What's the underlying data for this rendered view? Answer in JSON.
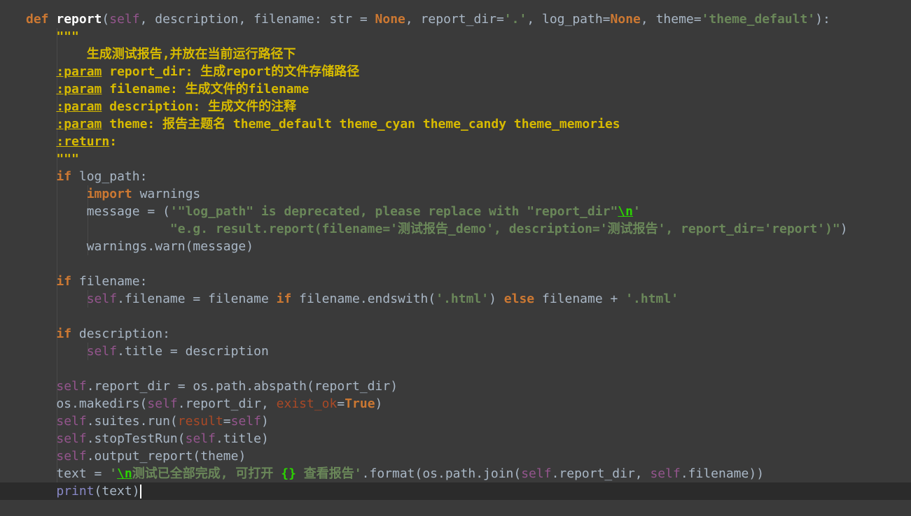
{
  "colors": {
    "background": "#3a3a3a",
    "current_line": "#2b2b2b",
    "default_text": "#a9b7c6",
    "keyword": "#cc7832",
    "function_name": "#ffffff",
    "self": "#94558d",
    "string": "#6a8759",
    "docstring": "#d7ba00",
    "escape": "#2bd400",
    "kwarg": "#aa4926",
    "builtin": "#8888c6"
  },
  "editor": {
    "cursor_line": 27,
    "lines": [
      [
        {
          "t": "def",
          "c": "kw"
        },
        {
          "t": " "
        },
        {
          "t": "report",
          "c": "fn"
        },
        {
          "t": "("
        },
        {
          "t": "self",
          "c": "self"
        },
        {
          "t": ", description, filename: str = "
        },
        {
          "t": "None",
          "c": "kw"
        },
        {
          "t": ", report_dir="
        },
        {
          "t": "'.'",
          "c": "str"
        },
        {
          "t": ", log_path="
        },
        {
          "t": "None",
          "c": "kw"
        },
        {
          "t": ", theme="
        },
        {
          "t": "'theme_default'",
          "c": "str"
        },
        {
          "t": "):"
        }
      ],
      [
        {
          "t": "    \"\"\"",
          "c": "doc"
        }
      ],
      [
        {
          "t": "        生成测试报告,并放在当前运行路径下",
          "c": "doc"
        }
      ],
      [
        {
          "t": "    "
        },
        {
          "t": ":param",
          "c": "doctag"
        },
        {
          "t": " report_dir",
          "c": "doc"
        },
        {
          "t": ": 生成report的文件存储路径",
          "c": "doc"
        }
      ],
      [
        {
          "t": "    "
        },
        {
          "t": ":param",
          "c": "doctag"
        },
        {
          "t": " filename",
          "c": "doc"
        },
        {
          "t": ": 生成文件的filename",
          "c": "doc"
        }
      ],
      [
        {
          "t": "    "
        },
        {
          "t": ":param",
          "c": "doctag"
        },
        {
          "t": " description",
          "c": "doc"
        },
        {
          "t": ": 生成文件的注释",
          "c": "doc"
        }
      ],
      [
        {
          "t": "    "
        },
        {
          "t": ":param",
          "c": "doctag"
        },
        {
          "t": " theme",
          "c": "doc"
        },
        {
          "t": ": 报告主题名 theme_default theme_cyan theme_candy theme_memories",
          "c": "doc"
        }
      ],
      [
        {
          "t": "    "
        },
        {
          "t": ":return",
          "c": "doctag"
        },
        {
          "t": ":",
          "c": "doc"
        }
      ],
      [
        {
          "t": "    \"\"\"",
          "c": "doc"
        }
      ],
      [
        {
          "t": "    "
        },
        {
          "t": "if",
          "c": "kw"
        },
        {
          "t": " log_path:"
        }
      ],
      [
        {
          "t": "        "
        },
        {
          "t": "import",
          "c": "kw"
        },
        {
          "t": " warnings"
        }
      ],
      [
        {
          "t": "        message = ("
        },
        {
          "t": "'\"log_path\" is deprecated, please replace with \"report_dir\"",
          "c": "str"
        },
        {
          "t": "\\n",
          "c": "esc"
        },
        {
          "t": "'",
          "c": "str"
        }
      ],
      [
        {
          "t": "                   "
        },
        {
          "t": "\"e.g. result.report(filename='测试报告_demo', description='测试报告', report_dir='report')\"",
          "c": "str"
        },
        {
          "t": ")"
        }
      ],
      [
        {
          "t": "        warnings.warn(message)"
        }
      ],
      [
        {
          "t": ""
        }
      ],
      [
        {
          "t": "    "
        },
        {
          "t": "if",
          "c": "kw"
        },
        {
          "t": " filename:"
        }
      ],
      [
        {
          "t": "        "
        },
        {
          "t": "self",
          "c": "self"
        },
        {
          "t": ".filename = filename "
        },
        {
          "t": "if",
          "c": "kw"
        },
        {
          "t": " filename.endswith("
        },
        {
          "t": "'.html'",
          "c": "str"
        },
        {
          "t": ") "
        },
        {
          "t": "else",
          "c": "kw"
        },
        {
          "t": " filename + "
        },
        {
          "t": "'.html'",
          "c": "str"
        }
      ],
      [
        {
          "t": ""
        }
      ],
      [
        {
          "t": "    "
        },
        {
          "t": "if",
          "c": "kw"
        },
        {
          "t": " description:"
        }
      ],
      [
        {
          "t": "        "
        },
        {
          "t": "self",
          "c": "self"
        },
        {
          "t": ".title = description"
        }
      ],
      [
        {
          "t": ""
        }
      ],
      [
        {
          "t": "    "
        },
        {
          "t": "self",
          "c": "self"
        },
        {
          "t": ".report_dir = os.path.abspath(report_dir)"
        }
      ],
      [
        {
          "t": "    os.makedirs("
        },
        {
          "t": "self",
          "c": "self"
        },
        {
          "t": ".report_dir, "
        },
        {
          "t": "exist_ok",
          "c": "kwarg"
        },
        {
          "t": "="
        },
        {
          "t": "True",
          "c": "kw"
        },
        {
          "t": ")"
        }
      ],
      [
        {
          "t": "    "
        },
        {
          "t": "self",
          "c": "self"
        },
        {
          "t": ".suites.run("
        },
        {
          "t": "result",
          "c": "kwarg"
        },
        {
          "t": "="
        },
        {
          "t": "self",
          "c": "self"
        },
        {
          "t": ")"
        }
      ],
      [
        {
          "t": "    "
        },
        {
          "t": "self",
          "c": "self"
        },
        {
          "t": ".stopTestRun("
        },
        {
          "t": "self",
          "c": "self"
        },
        {
          "t": ".title)"
        }
      ],
      [
        {
          "t": "    "
        },
        {
          "t": "self",
          "c": "self"
        },
        {
          "t": ".output_report(theme)"
        }
      ],
      [
        {
          "t": "    text = "
        },
        {
          "t": "'",
          "c": "str"
        },
        {
          "t": "\\n",
          "c": "esc"
        },
        {
          "t": "测试已全部完成, 可打开 ",
          "c": "str"
        },
        {
          "t": "{}",
          "c": "fmt"
        },
        {
          "t": " 查看报告'",
          "c": "str"
        },
        {
          "t": ".format(os.path.join("
        },
        {
          "t": "self",
          "c": "self"
        },
        {
          "t": ".report_dir, "
        },
        {
          "t": "self",
          "c": "self"
        },
        {
          "t": ".filename))"
        }
      ],
      [
        {
          "t": "    "
        },
        {
          "t": "print",
          "c": "bi"
        },
        {
          "t": "(text)"
        }
      ]
    ]
  }
}
